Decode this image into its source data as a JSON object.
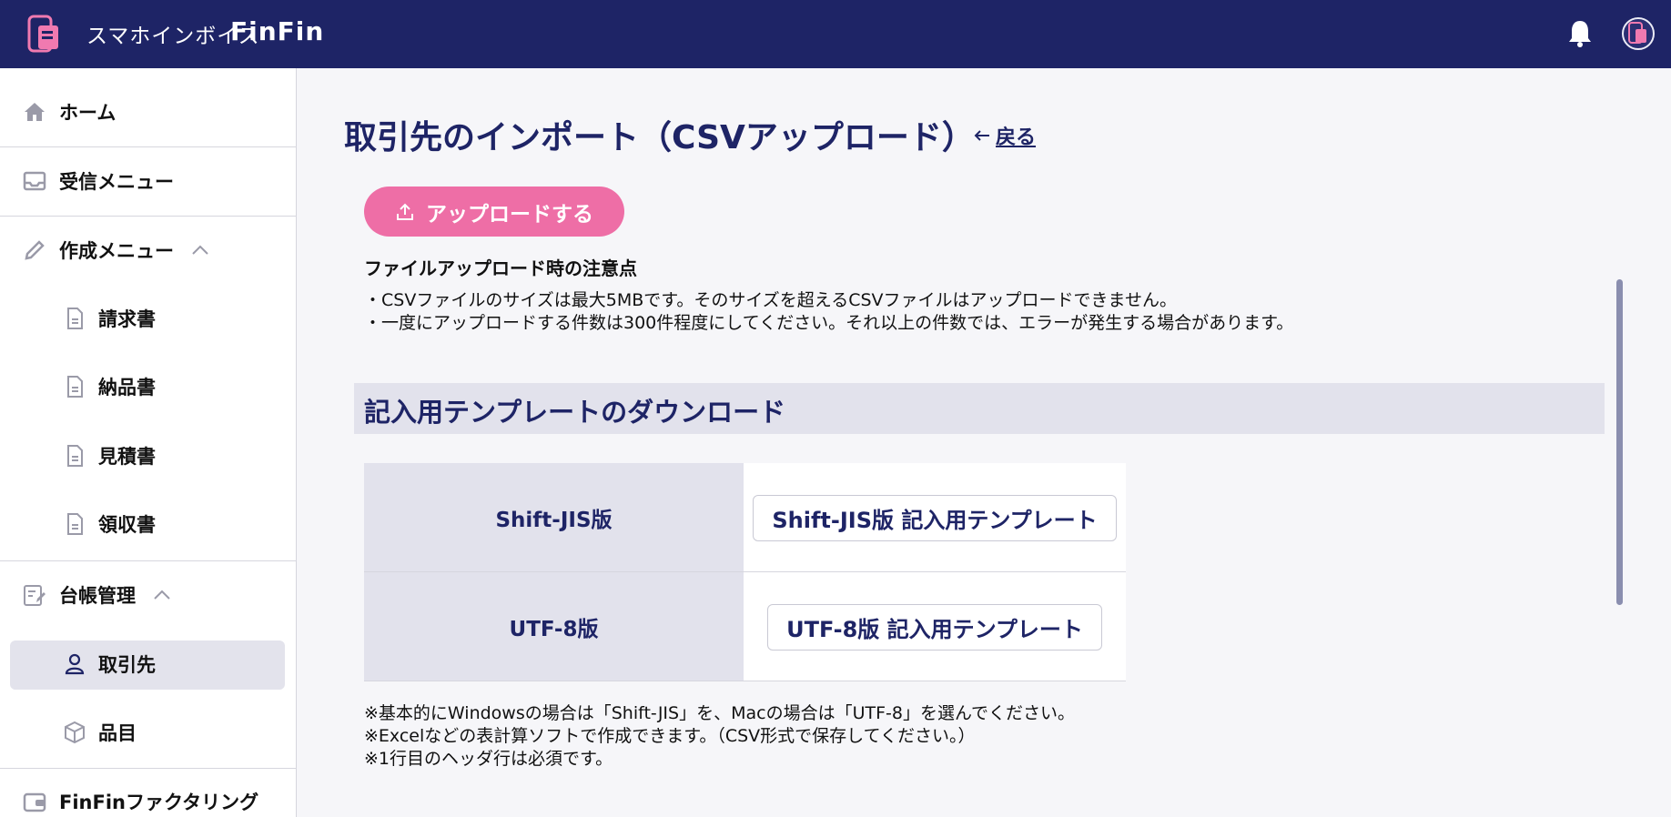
{
  "header": {
    "brand_sub": "スマホインボイス",
    "brand_name": "FinFin"
  },
  "sidebar": {
    "items": [
      {
        "label": "ホーム",
        "icon": "home-icon"
      },
      {
        "label": "受信メニュー",
        "icon": "inbox-icon"
      },
      {
        "label": "作成メニュー",
        "icon": "pencil-icon"
      },
      {
        "label": "請求書",
        "icon": "document-icon"
      },
      {
        "label": "納品書",
        "icon": "document-icon"
      },
      {
        "label": "見積書",
        "icon": "document-icon"
      },
      {
        "label": "領収書",
        "icon": "document-icon"
      },
      {
        "label": "台帳管理",
        "icon": "ledger-icon"
      },
      {
        "label": "取引先",
        "icon": "person-icon"
      },
      {
        "label": "品目",
        "icon": "box-icon"
      },
      {
        "label": "FinFinファクタリング",
        "icon": "wallet-icon"
      }
    ]
  },
  "main": {
    "title": "取引先のインポート（CSVアップロード）",
    "back_label": "戻る",
    "upload_label": "アップロードする",
    "notice_title": "ファイルアップロード時の注意点",
    "notice_lines": [
      "・CSVファイルのサイズは最大5MBです。そのサイズを超えるCSVファイルはアップロードできません。",
      "・一度にアップロードする件数は300件程度にしてください。それ以上の件数では、エラーが発生する場合があります。"
    ],
    "section_title": "記入用テンプレートのダウンロード",
    "templates": [
      {
        "head": "Shift-JIS版",
        "button": "Shift-JIS版 記入用テンプレート"
      },
      {
        "head": "UTF-8版",
        "button": "UTF-8版 記入用テンプレート"
      }
    ],
    "footnotes": [
      "※基本的にWindowsの場合は「Shift-JIS」を、Macの場合は「UTF-8」を選んでください。",
      "※Excelなどの表計算ソフトで作成できます。（CSV形式で保存してください。）",
      "※1行目のヘッダ行は必須です。"
    ]
  },
  "colors": {
    "header_bg": "#1e2466",
    "accent_pink": "#ee6ea6",
    "navy_text": "#1e2466",
    "section_bg": "#e2e2ec"
  }
}
